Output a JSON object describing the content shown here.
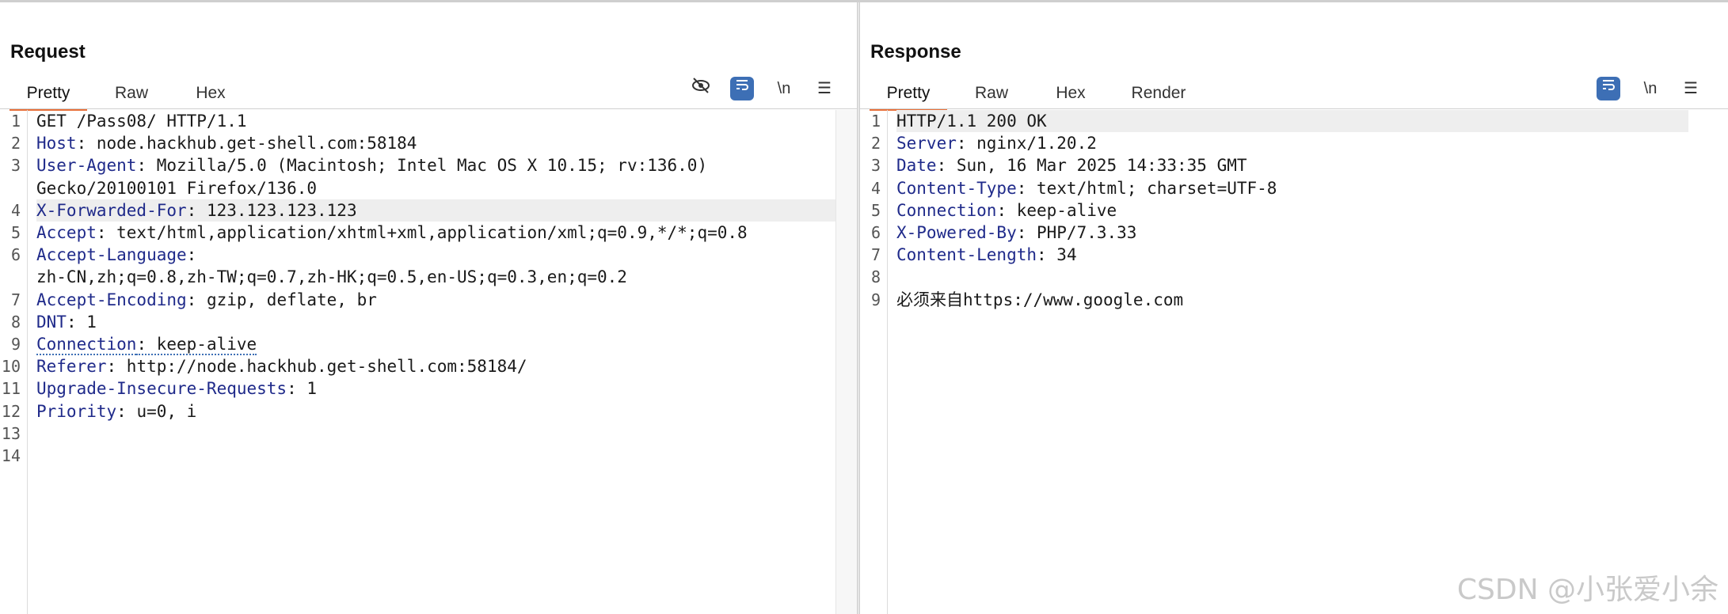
{
  "request": {
    "title": "Request",
    "tabs": [
      "Pretty",
      "Raw",
      "Hex"
    ],
    "active_tab": "Pretty",
    "toolbar": [
      "hide-icon",
      "wrap-icon",
      "newline-icon",
      "menu-icon"
    ],
    "newline_label": "\\n",
    "lines": [
      {
        "n": "1",
        "parts": [
          {
            "t": "GET /Pass08/ HTTP/1.1",
            "c": "hv"
          }
        ]
      },
      {
        "n": "2",
        "parts": [
          {
            "t": "Host",
            "c": "hk"
          },
          {
            "t": ": node.hackhub.get-shell.com:58184",
            "c": "hv"
          }
        ]
      },
      {
        "n": "3",
        "parts": [
          {
            "t": "User-Agent",
            "c": "hk"
          },
          {
            "t": ": Mozilla/5.0 (Macintosh; Intel Mac OS X 10.15; rv:136.0)",
            "c": "hv"
          }
        ]
      },
      {
        "n": "",
        "parts": [
          {
            "t": "Gecko/20100101 Firefox/136.0",
            "c": "hv"
          }
        ]
      },
      {
        "n": "4",
        "hl": true,
        "parts": [
          {
            "t": "X-Forwarded-For",
            "c": "hk"
          },
          {
            "t": ": 123.123.123.123",
            "c": "hv"
          }
        ]
      },
      {
        "n": "5",
        "parts": [
          {
            "t": "Accept",
            "c": "hk"
          },
          {
            "t": ": text/html,application/xhtml+xml,application/xml;q=0.9,*/*;q=0.8",
            "c": "hv"
          }
        ]
      },
      {
        "n": "6",
        "parts": [
          {
            "t": "Accept-Language",
            "c": "hk"
          },
          {
            "t": ":",
            "c": "hv"
          }
        ]
      },
      {
        "n": "",
        "parts": [
          {
            "t": "zh-CN,zh;q=0.8,zh-TW;q=0.7,zh-HK;q=0.5,en-US;q=0.3,en;q=0.2",
            "c": "hv"
          }
        ]
      },
      {
        "n": "7",
        "parts": [
          {
            "t": "Accept-Encoding",
            "c": "hk"
          },
          {
            "t": ": gzip, deflate, br",
            "c": "hv"
          }
        ]
      },
      {
        "n": "8",
        "parts": [
          {
            "t": "DNT",
            "c": "hk"
          },
          {
            "t": ": 1",
            "c": "hv"
          }
        ]
      },
      {
        "n": "9",
        "parts": [
          {
            "t": "Connection",
            "c": "hk dotted"
          },
          {
            "t": ": keep-alive",
            "c": "hv dotted"
          }
        ]
      },
      {
        "n": "10",
        "parts": [
          {
            "t": "Referer",
            "c": "hk"
          },
          {
            "t": ": http://node.hackhub.get-shell.com:58184/",
            "c": "hv"
          }
        ]
      },
      {
        "n": "11",
        "parts": [
          {
            "t": "Upgrade-Insecure-Requests",
            "c": "hk"
          },
          {
            "t": ": 1",
            "c": "hv"
          }
        ]
      },
      {
        "n": "12",
        "parts": [
          {
            "t": "Priority",
            "c": "hk"
          },
          {
            "t": ": u=0, i",
            "c": "hv"
          }
        ]
      },
      {
        "n": "13",
        "parts": []
      },
      {
        "n": "14",
        "parts": []
      }
    ]
  },
  "response": {
    "title": "Response",
    "tabs": [
      "Pretty",
      "Raw",
      "Hex",
      "Render"
    ],
    "active_tab": "Pretty",
    "toolbar": [
      "wrap-icon",
      "newline-icon",
      "menu-icon"
    ],
    "newline_label": "\\n",
    "lines": [
      {
        "n": "1",
        "hl": true,
        "parts": [
          {
            "t": "HTTP/1.1 200 OK",
            "c": "hv"
          }
        ]
      },
      {
        "n": "2",
        "parts": [
          {
            "t": "Server",
            "c": "hk"
          },
          {
            "t": ": nginx/1.20.2",
            "c": "hv"
          }
        ]
      },
      {
        "n": "3",
        "parts": [
          {
            "t": "Date",
            "c": "hk"
          },
          {
            "t": ": Sun, 16 Mar 2025 14:33:35 GMT",
            "c": "hv"
          }
        ]
      },
      {
        "n": "4",
        "parts": [
          {
            "t": "Content-Type",
            "c": "hk"
          },
          {
            "t": ": text/html; charset=UTF-8",
            "c": "hv"
          }
        ]
      },
      {
        "n": "5",
        "parts": [
          {
            "t": "Connection",
            "c": "hk"
          },
          {
            "t": ": keep-alive",
            "c": "hv"
          }
        ]
      },
      {
        "n": "6",
        "parts": [
          {
            "t": "X-Powered-By",
            "c": "hk"
          },
          {
            "t": ": PHP/7.3.33",
            "c": "hv"
          }
        ]
      },
      {
        "n": "7",
        "parts": [
          {
            "t": "Content-Length",
            "c": "hk"
          },
          {
            "t": ": 34",
            "c": "hv"
          }
        ]
      },
      {
        "n": "8",
        "parts": []
      },
      {
        "n": "9",
        "parts": [
          {
            "t": "必须来自https://www.google.com",
            "c": "hv"
          }
        ]
      }
    ]
  },
  "layout_modes": [
    "split-horizontal-icon",
    "split-vertical-icon",
    "single-pane-icon"
  ],
  "active_layout": "split-horizontal-icon",
  "watermark": "CSDN @小张爱小余",
  "colors": {
    "accent": "#3d6fb5",
    "tab_underline": "#e8703a",
    "header_key": "#1f2a8a"
  }
}
